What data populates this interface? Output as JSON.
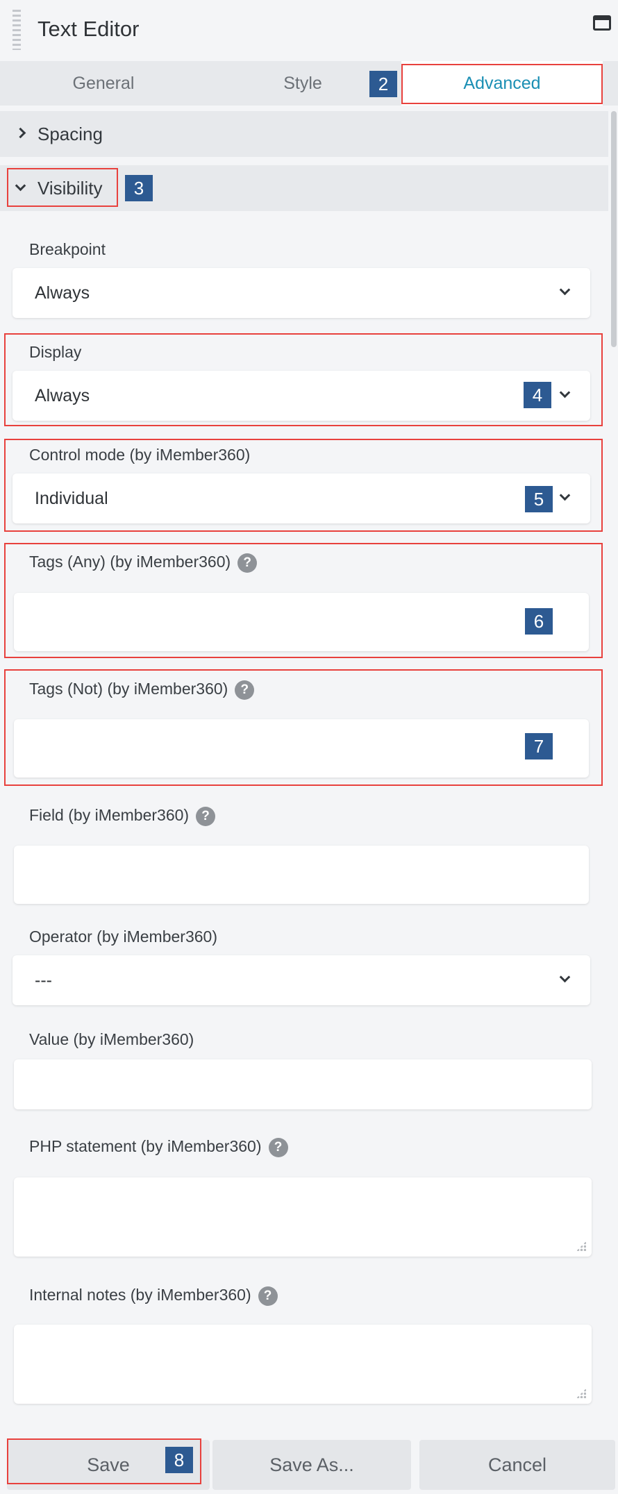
{
  "window": {
    "title": "Text Editor",
    "icons": [
      "drag-handle-icon",
      "window-icon"
    ]
  },
  "tabs": [
    {
      "label": "General",
      "active": false
    },
    {
      "label": "Style",
      "active": false
    },
    {
      "label": "Advanced",
      "active": true
    }
  ],
  "sections": {
    "spacing": {
      "label": "Spacing",
      "expanded": false
    },
    "visibility": {
      "label": "Visibility",
      "expanded": true
    }
  },
  "fields": {
    "breakpoint": {
      "label": "Breakpoint",
      "value": "Always"
    },
    "display": {
      "label": "Display",
      "value": "Always"
    },
    "control_mode": {
      "label": "Control mode  (by iMember360)",
      "value": "Individual"
    },
    "tags_any": {
      "label": "Tags (Any) (by iMember360)",
      "value": ""
    },
    "tags_not": {
      "label": "Tags (Not) (by iMember360)",
      "value": ""
    },
    "field": {
      "label": "Field (by iMember360)",
      "value": ""
    },
    "operator": {
      "label": "Operator (by iMember360)",
      "value": "---"
    },
    "value": {
      "label": "Value (by iMember360)",
      "value": ""
    },
    "php_statement": {
      "label": "PHP statement  (by iMember360)",
      "value": ""
    },
    "internal_notes": {
      "label": "Internal notes  (by iMember360)",
      "value": ""
    }
  },
  "help_glyph": "?",
  "footer": {
    "save": "Save",
    "save_as": "Save As...",
    "cancel": "Cancel"
  },
  "annotations": [
    "2",
    "3",
    "4",
    "5",
    "6",
    "7",
    "8"
  ],
  "colors": {
    "accent": "#1b8fb4",
    "annotation_box": "#e8413d",
    "annotation_badge": "#2d5a92",
    "panel_bg": "#f4f5f7"
  }
}
